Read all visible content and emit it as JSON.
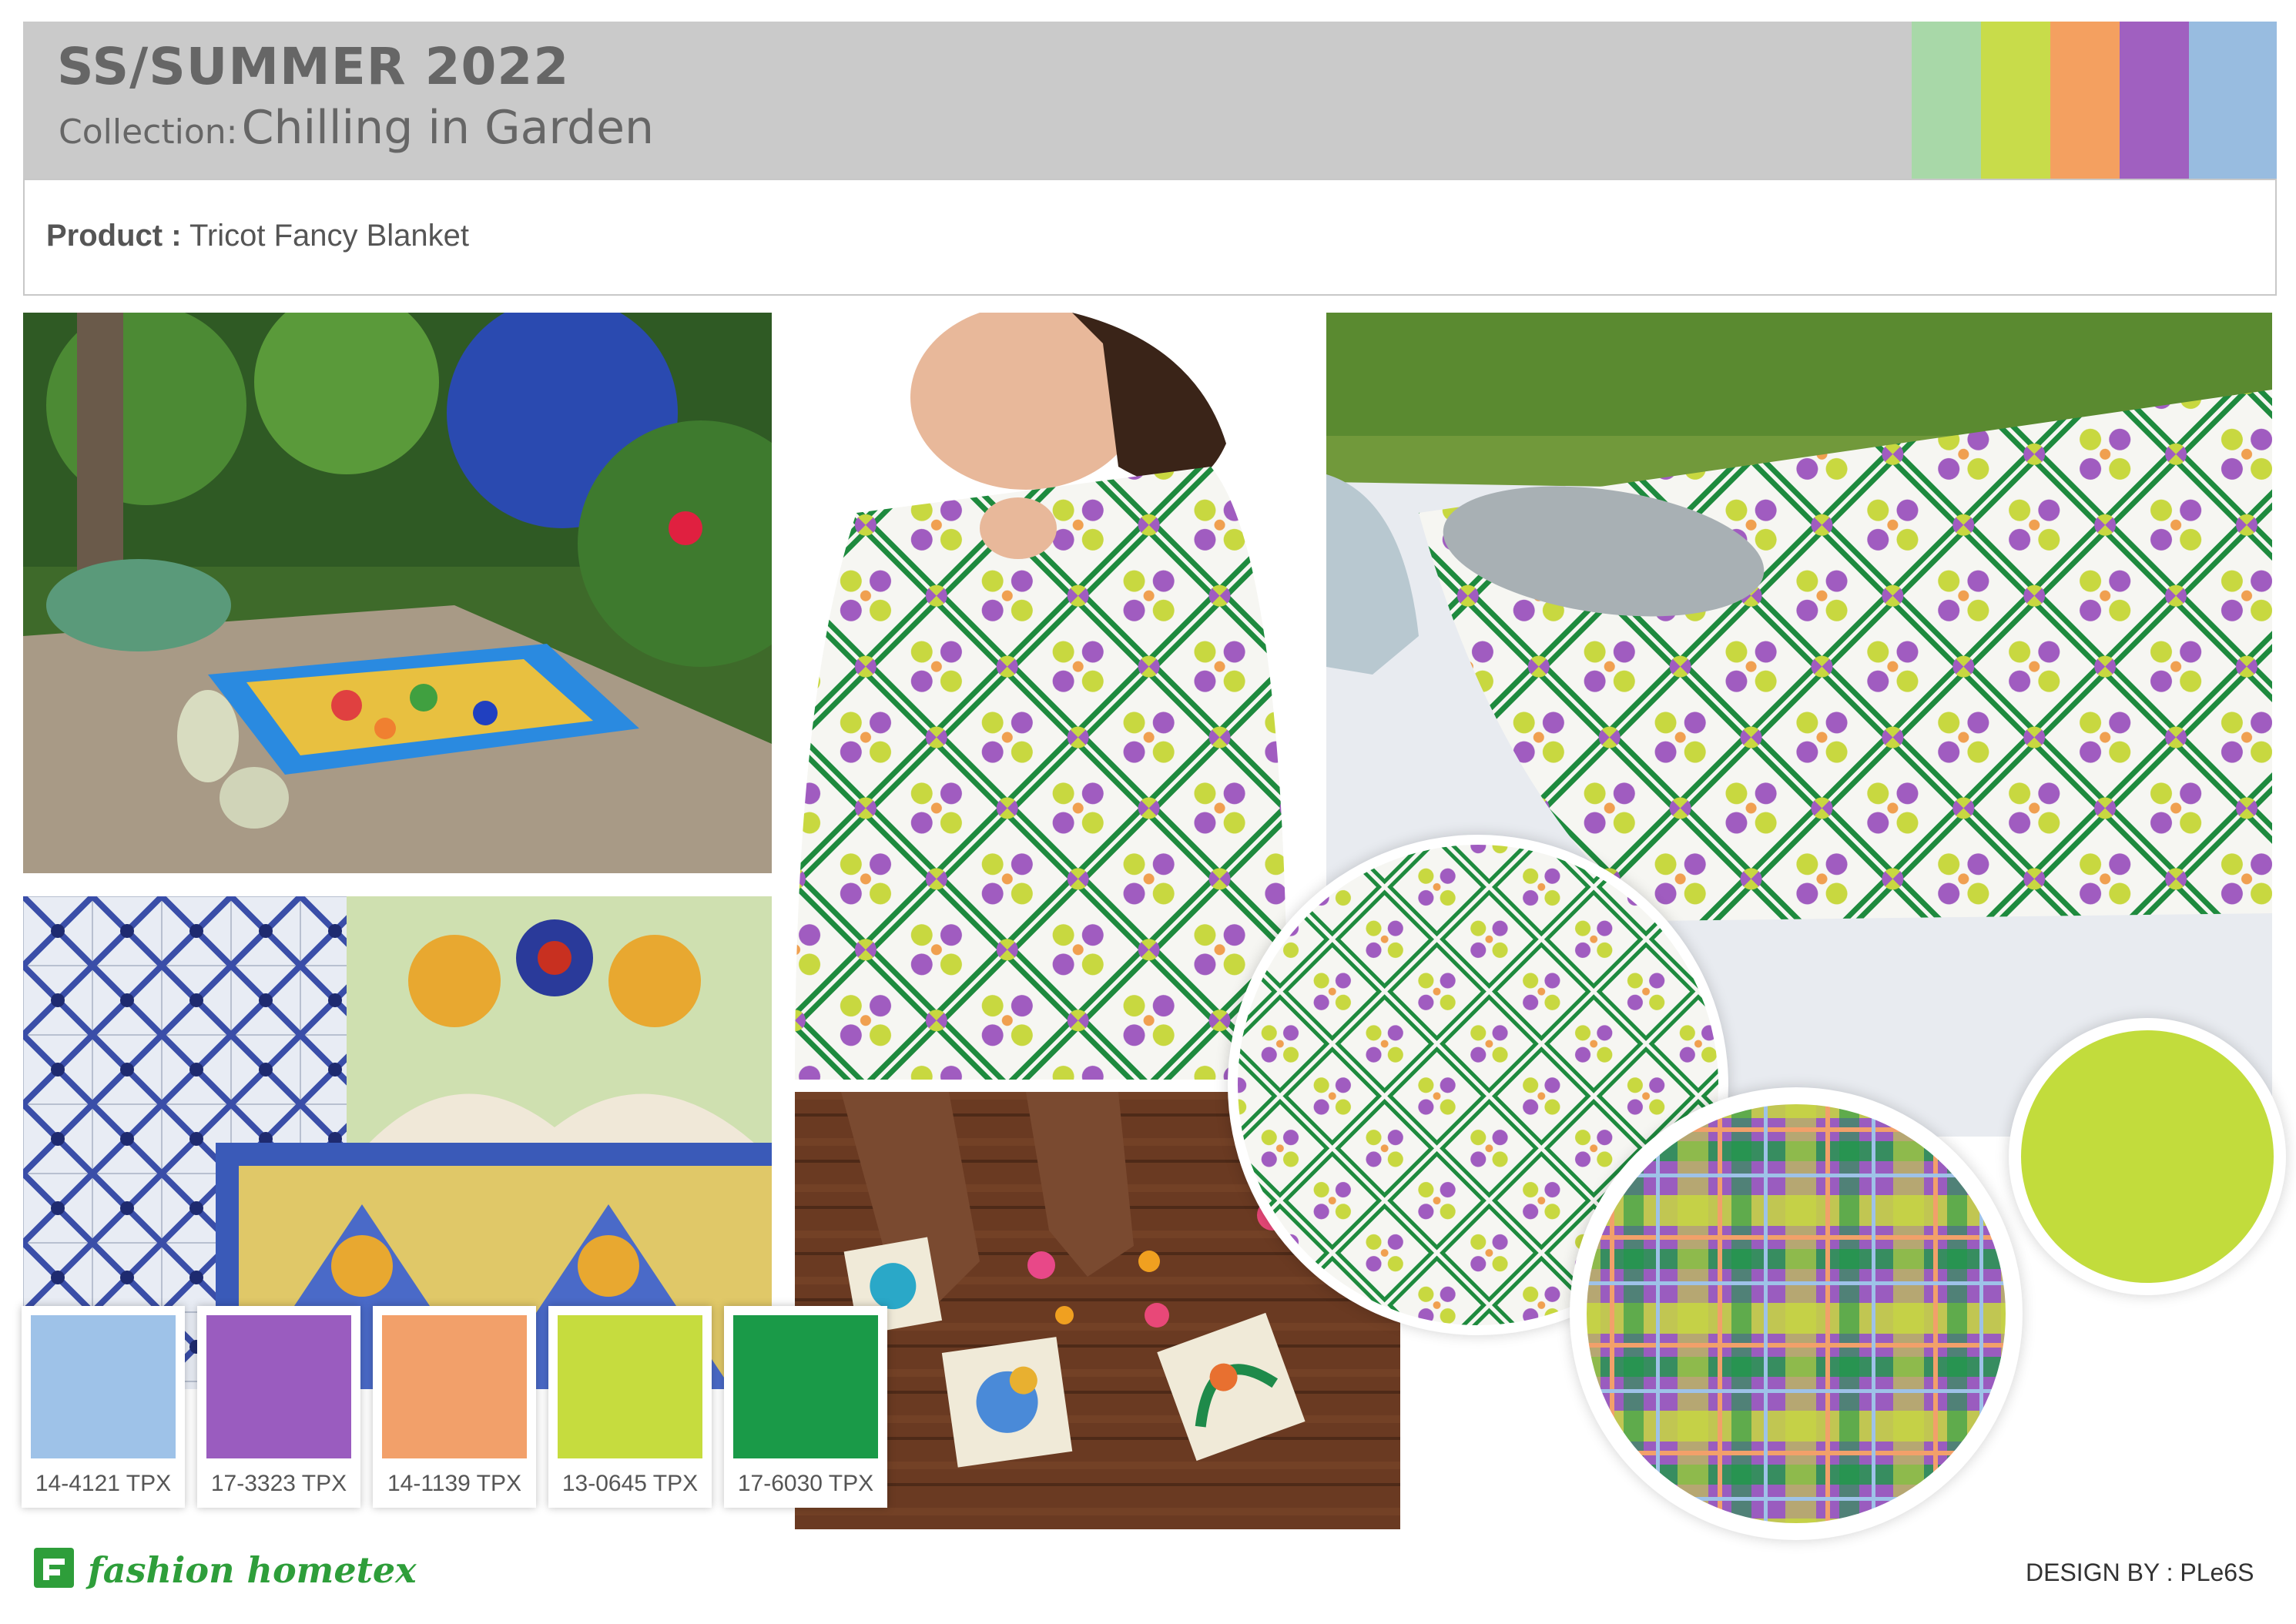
{
  "header": {
    "season": "SS/SUMMER 2022",
    "collection_label": "Collection:",
    "collection_name": "Chilling in Garden",
    "palette_band": [
      "#a8d8a8",
      "#c8dc4a",
      "#f4a060",
      "#a060c0",
      "#98bce0"
    ]
  },
  "product": {
    "label": "Product :",
    "value": "Tricot Fancy Blanket"
  },
  "swatches": [
    {
      "code": "14-4121 TPX",
      "color": "#9ec2e8"
    },
    {
      "code": "17-3323 TPX",
      "color": "#9a5cbf"
    },
    {
      "code": "14-1139 TPX",
      "color": "#f2a06a"
    },
    {
      "code": "13-0645 TPX",
      "color": "#c6dc3e"
    },
    {
      "code": "17-6030 TPX",
      "color": "#1a9a48"
    }
  ],
  "solid_circle_color": "#c2dc3c",
  "footer": {
    "brand": "fashion hometex",
    "designer": "DESIGN BY : PLe6S"
  }
}
